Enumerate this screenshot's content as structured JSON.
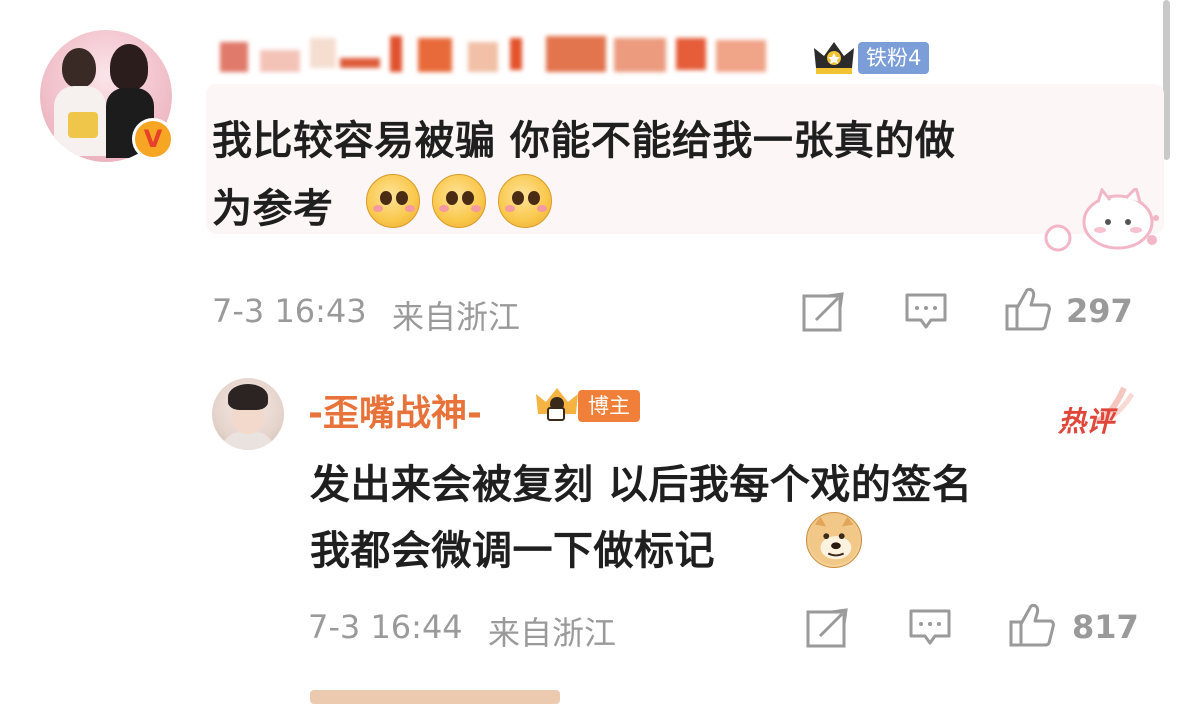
{
  "comment": {
    "fan_badge": "铁粉4",
    "text_line1": "我比较容易被骗 你能不能给我一张真的做",
    "text_line2": "为参考",
    "time": "7-3 16:43",
    "location": "来自浙江",
    "like_count": "297",
    "emoji_icons": [
      "pleading-face-icon",
      "pleading-face-icon",
      "pleading-face-icon"
    ],
    "verified_badge": "V"
  },
  "reply": {
    "author": "-歪嘴战神-",
    "author_badge": "博主",
    "hot_label": "热评",
    "text_line1": "发出来会被复刻 以后我每个戏的签名",
    "text_line2": "我都会微调一下做标记",
    "emoji_icon": "doge-icon",
    "time": "7-3 16:44",
    "location": "来自浙江",
    "like_count": "817"
  },
  "colors": {
    "text": "#1f1f1f",
    "meta": "#9a9a9a",
    "reply_name": "#e8733a",
    "fan_badge": "#7b9ed8",
    "author_badge": "#f07f3a",
    "hot": "#e0473a",
    "bubble_bg": "#fdf6f7"
  }
}
